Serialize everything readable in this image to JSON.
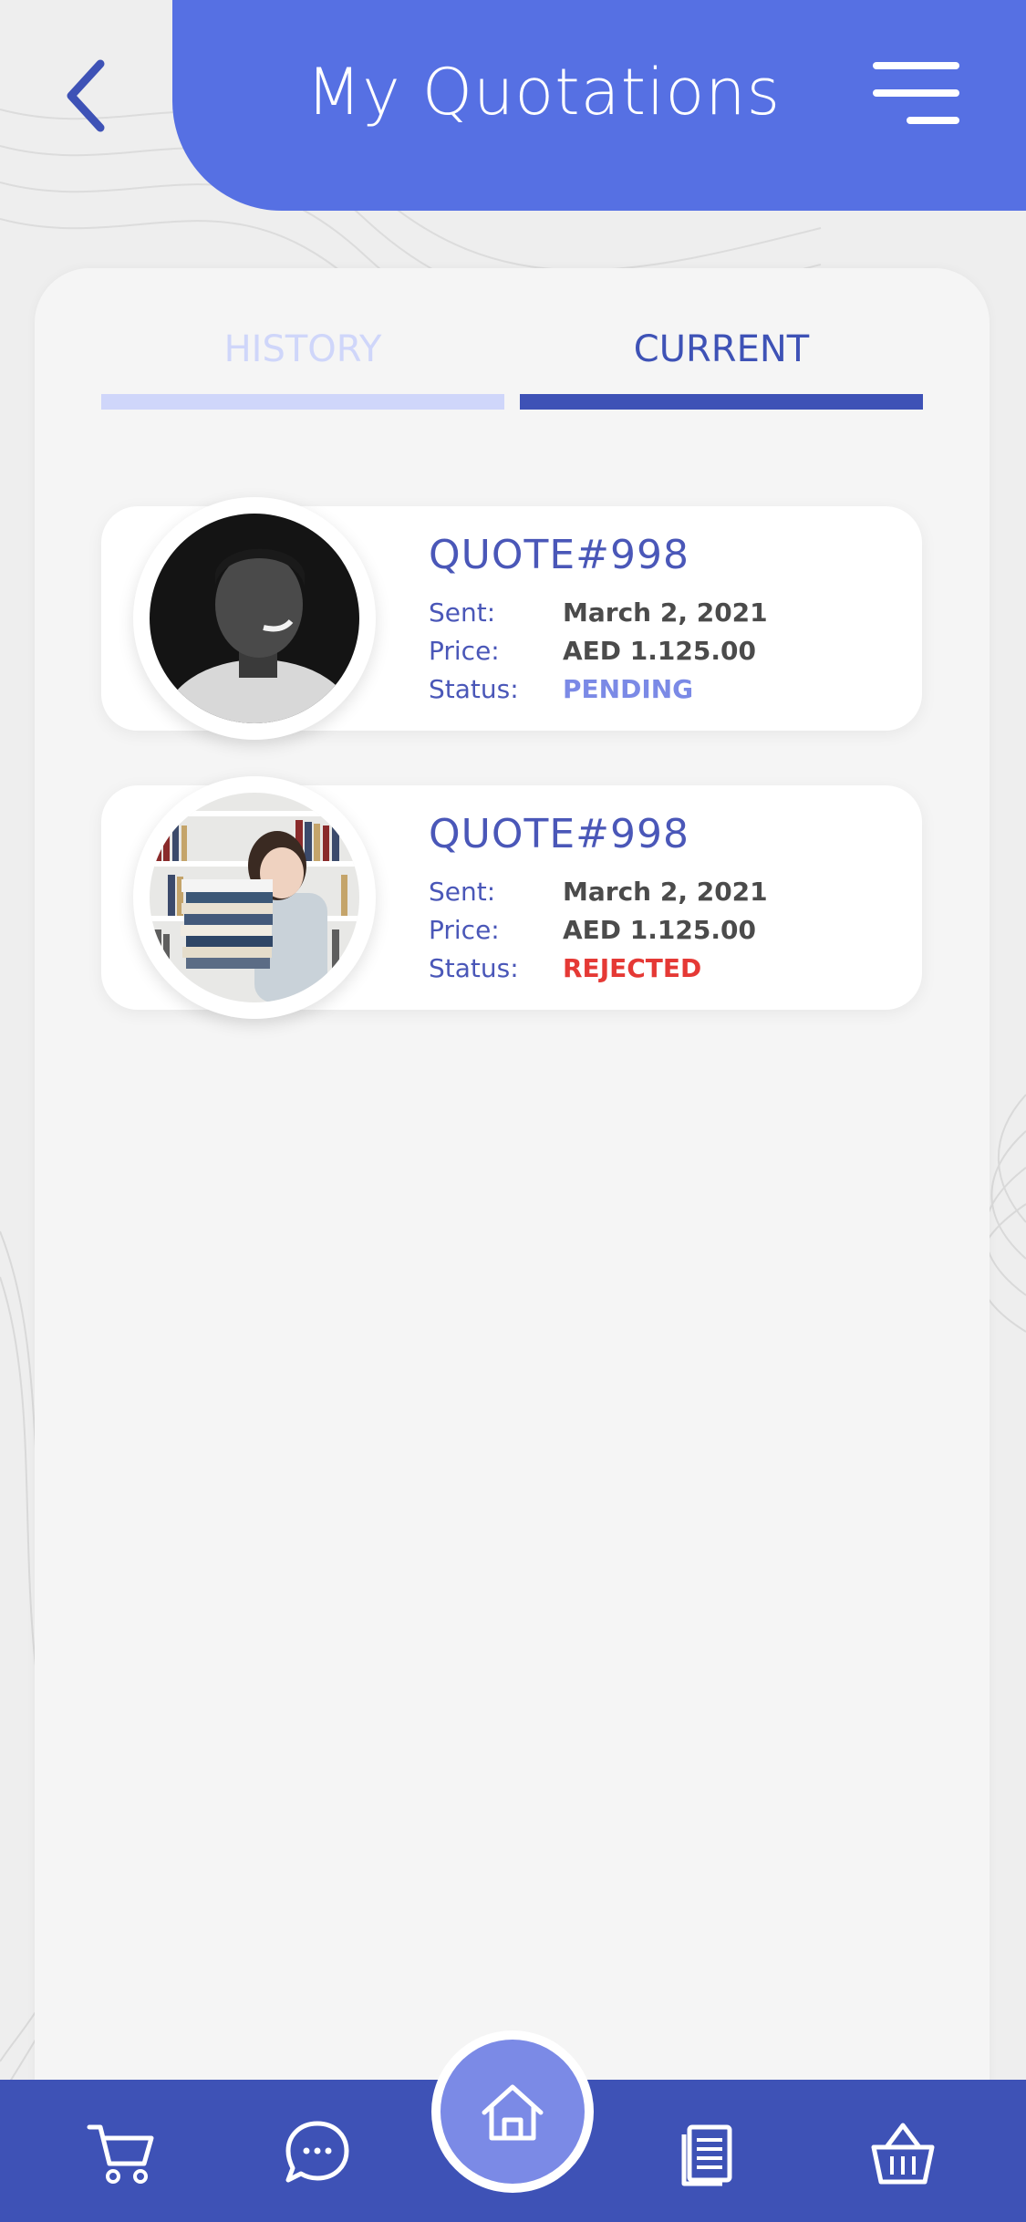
{
  "header": {
    "title": "My Quotations",
    "back_icon": "chevron-left-icon",
    "menu_icon": "hamburger-menu-icon",
    "background": "#5670e3"
  },
  "tabs": [
    {
      "label": "HISTORY",
      "active": false,
      "color": "#cfd6fa"
    },
    {
      "label": "CURRENT",
      "active": true,
      "color": "#3e52b6"
    }
  ],
  "quotes": [
    {
      "title": "QUOTE#998",
      "sent_label": "Sent:",
      "sent_value": "March 2, 2021",
      "price_label": "Price:",
      "price_value": "AED 1.125.00",
      "status_label": "Status:",
      "status_value": "PENDING",
      "status_color": "#7b8ae6",
      "avatar": "man-portrait-photo"
    },
    {
      "title": "QUOTE#998",
      "sent_label": "Sent:",
      "sent_value": "March 2, 2021",
      "price_label": "Price:",
      "price_value": "AED 1.125.00",
      "status_label": "Status:",
      "status_value": "REJECTED",
      "status_color": "#e53935",
      "avatar": "woman-with-books-photo"
    }
  ],
  "bottom_nav": {
    "items": [
      "cart-icon",
      "chat-icon",
      "home-icon",
      "document-icon",
      "basket-icon"
    ],
    "background": "#3e52b6",
    "active_color": "#7b8ae6"
  }
}
